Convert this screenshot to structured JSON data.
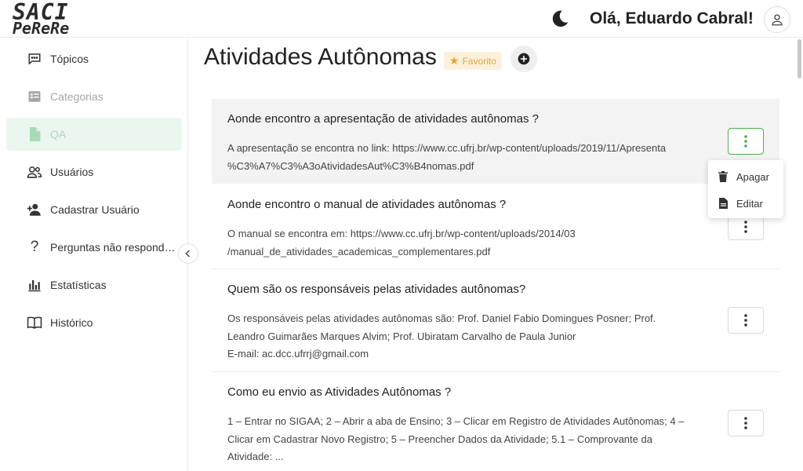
{
  "header": {
    "logo_line1": "SACI",
    "logo_line2": "PeReRe",
    "greeting": "Olá, Eduardo Cabral!"
  },
  "sidebar": {
    "items": [
      {
        "label": "Tópicos",
        "icon": "chat-icon",
        "state": "normal"
      },
      {
        "label": "Categorias",
        "icon": "list-icon",
        "state": "disabled"
      },
      {
        "label": "QA",
        "icon": "file-icon",
        "state": "active"
      },
      {
        "label": "Usuários",
        "icon": "users-icon",
        "state": "normal"
      },
      {
        "label": "Cadastrar Usuário",
        "icon": "user-plus-icon",
        "state": "normal"
      },
      {
        "label": "Perguntas não respondidas",
        "icon": "question-icon",
        "state": "normal"
      },
      {
        "label": "Estatísticas",
        "icon": "bar-chart-icon",
        "state": "normal"
      },
      {
        "label": "Histórico",
        "icon": "book-icon",
        "state": "normal"
      }
    ]
  },
  "main": {
    "title": "Atividades Autônomas",
    "favorite_label": "Favorito",
    "qa_list": [
      {
        "question": "Aonde encontro a apresentação de atividades autônomas ?",
        "answer_lines": [
          "A apresentação se encontra no link: https://www.cc.ufrj.br/wp-content/uploads/2019/11/Apresenta",
          "%C3%A7%C3%A3oAtividadesAut%C3%B4nomas.pdf"
        ]
      },
      {
        "question": "Aonde encontro o manual de atividades autônomas ?",
        "answer_lines": [
          "O manual se encontra em: https://www.cc.ufrj.br/wp-content/uploads/2014/03",
          "/manual_de_atividades_academicas_complementares.pdf"
        ]
      },
      {
        "question": "Quem são os responsáveis pelas atividades autônomas?",
        "answer_lines": [
          "Os responsáveis pelas atividades autônomas são: Prof. Daniel Fabio Domingues Posner; Prof.",
          "Leandro Guimarães Marques Alvim; Prof. Ubiratam Carvalho de Paula Junior",
          "E-mail: ac.dcc.ufrrj@gmail.com"
        ]
      },
      {
        "question": "Como eu envio as Atividades Autônomas ?",
        "answer_lines": [
          "1 – Entrar no SIGAA; 2 – Abrir a aba de Ensino; 3 – Clicar em Registro de Atividades Autônomas; 4 –",
          "Clicar em Cadastrar Novo Registro; 5 – Preencher Dados da Atividade; 5.1 – Comprovante da",
          "Atividade: ..."
        ]
      }
    ]
  },
  "context_menu": {
    "items": [
      {
        "label": "Apagar",
        "icon": "trash-icon"
      },
      {
        "label": "Editar",
        "icon": "document-icon"
      }
    ]
  },
  "colors": {
    "active_bg": "#ebf7ee",
    "active_fg": "#a7dbb6",
    "favorite_bg": "#fdf1dc",
    "favorite_fg": "#e6a33a",
    "kebab_active_border": "#4caf50"
  }
}
